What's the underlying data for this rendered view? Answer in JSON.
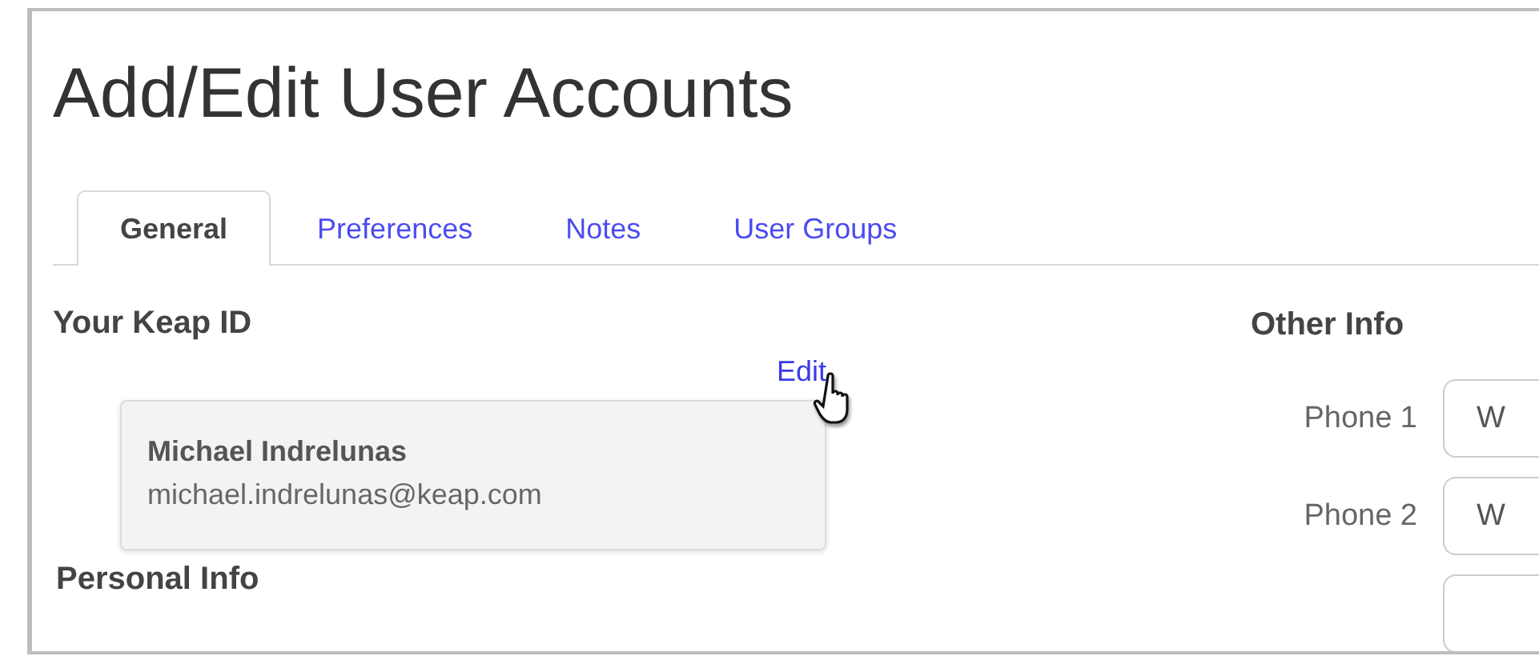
{
  "page": {
    "title": "Add/Edit User Accounts"
  },
  "tabs": [
    {
      "label": "General",
      "selected": true
    },
    {
      "label": "Preferences",
      "selected": false
    },
    {
      "label": "Notes",
      "selected": false
    },
    {
      "label": "User Groups",
      "selected": false
    }
  ],
  "keap_id": {
    "heading": "Your Keap ID",
    "edit_link": "Edit",
    "name": "Michael Indrelunas",
    "email": "michael.indrelunas@keap.com"
  },
  "personal_info": {
    "heading": "Personal Info"
  },
  "other_info": {
    "heading": "Other Info",
    "phones": [
      {
        "kind": "full",
        "label": "Phone 1",
        "value": "W"
      },
      {
        "kind": "full",
        "label": "Phone 2",
        "value": "W"
      },
      {
        "kind": "cut"
      }
    ]
  }
}
